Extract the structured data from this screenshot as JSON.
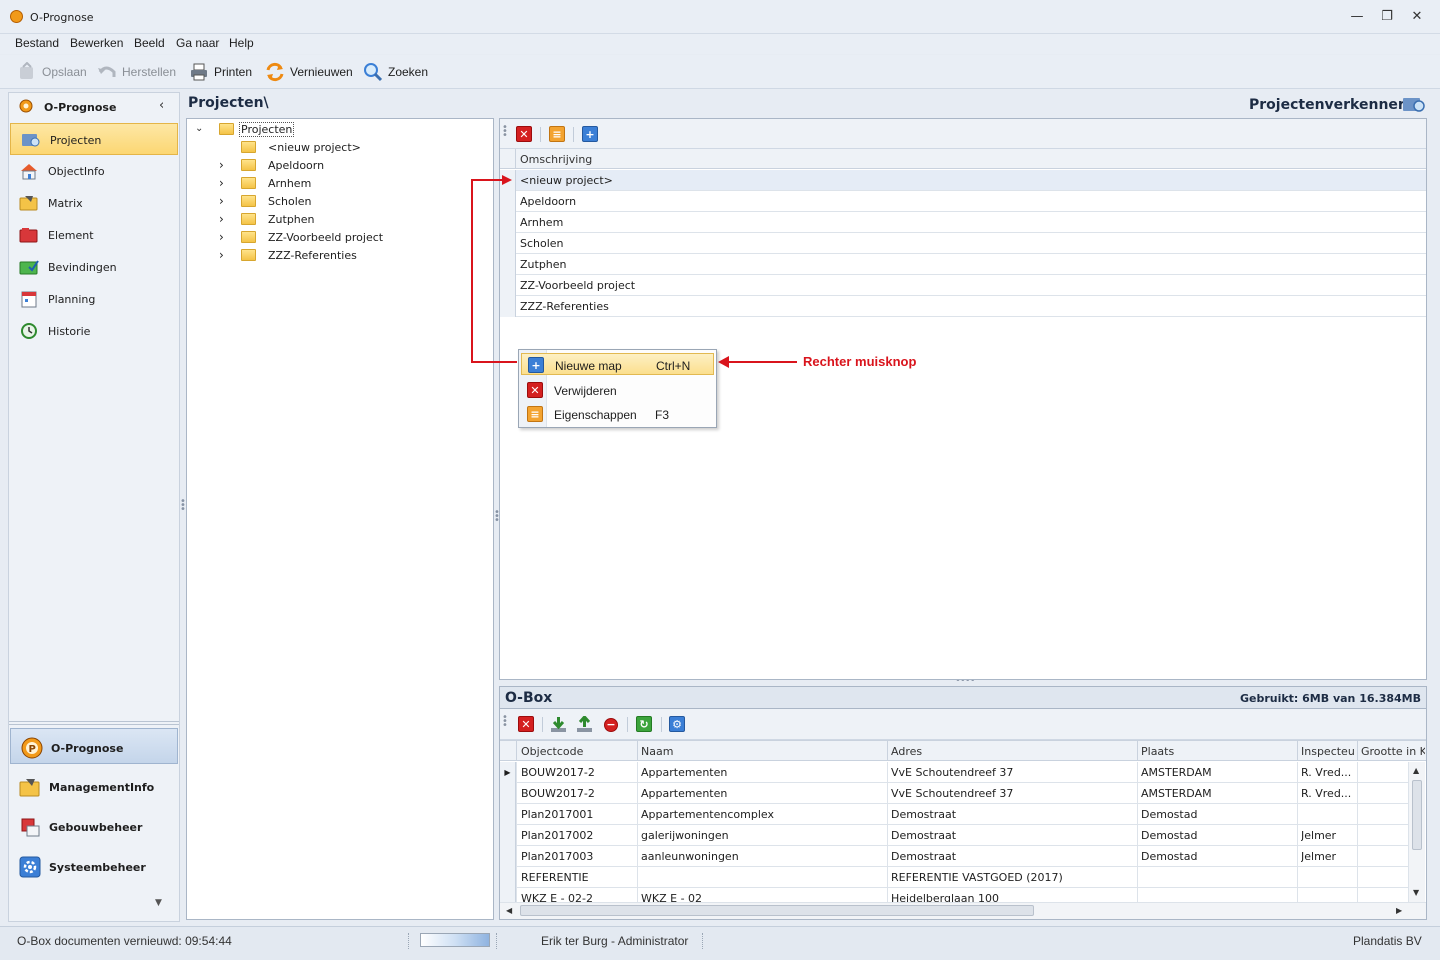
{
  "window": {
    "title": "O-Prognose",
    "controls": [
      "minimize",
      "maximize",
      "close"
    ]
  },
  "menu": [
    "Bestand",
    "Bewerken",
    "Beeld",
    "Ga naar",
    "Help"
  ],
  "toolbar": {
    "save": "Opslaan",
    "restore": "Herstellen",
    "print": "Printen",
    "refresh": "Vernieuwen",
    "search": "Zoeken"
  },
  "nav": {
    "header": "O-Prognose",
    "items": [
      "Projecten",
      "ObjectInfo",
      "Matrix",
      "Element",
      "Bevindingen",
      "Planning",
      "Historie"
    ],
    "active_index": 0,
    "bottom": [
      "O-Prognose",
      "ManagementInfo",
      "Gebouwbeheer",
      "Systeembeheer"
    ],
    "bottom_active_index": 0
  },
  "breadcrumb": "Projecten\\",
  "explorer_title": "Projectenverkenner",
  "tree": {
    "root": "Projecten",
    "children": [
      "<nieuw project>",
      "Apeldoorn",
      "Arnhem",
      "Scholen",
      "Zutphen",
      "ZZ-Voorbeeld project",
      "ZZZ-Referenties"
    ]
  },
  "projects_grid": {
    "column": "Omschrijving",
    "rows": [
      "<nieuw project>",
      "Apeldoorn",
      "Arnhem",
      "Scholen",
      "Zutphen",
      "ZZ-Voorbeeld project",
      "ZZZ-Referenties"
    ]
  },
  "context_menu": {
    "items": [
      {
        "label": "Nieuwe map",
        "shortcut": "Ctrl+N",
        "icon": "plus-icon"
      },
      {
        "label": "Verwijderen",
        "shortcut": "",
        "icon": "delete-icon"
      },
      {
        "label": "Eigenschappen",
        "shortcut": "F3",
        "icon": "properties-icon"
      }
    ]
  },
  "annotation": "Rechter muisknop",
  "obox": {
    "title": "O-Box",
    "usage": "Gebruikt: 6MB van 16.384MB",
    "columns": [
      "Objectcode",
      "Naam",
      "Adres",
      "Plaats",
      "Inspecteur",
      "Grootte in KB"
    ],
    "rows": [
      [
        "BOUW2017-2",
        "Appartementen",
        "VvE Schoutendreef 37",
        "AMSTERDAM",
        "R. Vred..."
      ],
      [
        "BOUW2017-2",
        "Appartementen",
        "VvE Schoutendreef 37",
        "AMSTERDAM",
        "R. Vred..."
      ],
      [
        "Plan2017001",
        "Appartementencomplex",
        "Demostraat",
        "Demostad",
        ""
      ],
      [
        "Plan2017002",
        "galerijwoningen",
        "Demostraat",
        "Demostad",
        "Jelmer"
      ],
      [
        "Plan2017003",
        "aanleunwoningen",
        "Demostraat",
        "Demostad",
        "Jelmer"
      ],
      [
        "REFERENTIE",
        "",
        "REFERENTIE VASTGOED (2017)",
        "",
        ""
      ],
      [
        "WKZ E - 02-2",
        "WKZ E - 02",
        "Heidelberglaan 100",
        "",
        ""
      ]
    ]
  },
  "status": {
    "left": "O-Box documenten vernieuwd: 09:54:44",
    "user": "Erik ter Burg - Administrator",
    "company": "Plandatis BV"
  },
  "colors": {
    "accent_red": "#d9141c",
    "highlight": "#fcd773"
  }
}
